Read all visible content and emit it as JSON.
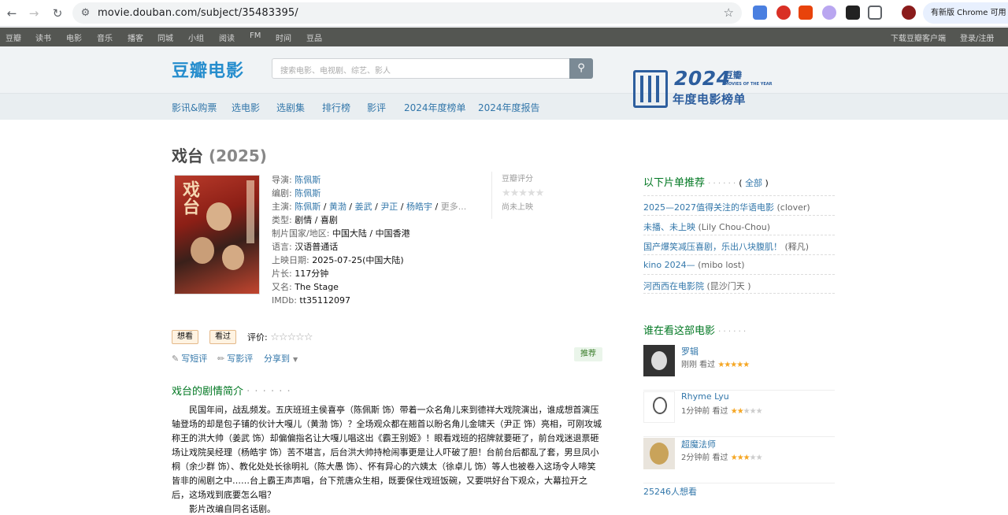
{
  "browser": {
    "url": "movie.douban.com/subject/35483395/",
    "update_label": "有新版 Chrome 可用"
  },
  "topnav": {
    "left": [
      "豆瓣",
      "读书",
      "电影",
      "音乐",
      "播客",
      "同城",
      "小组",
      "阅读",
      "FM",
      "时间",
      "豆品"
    ],
    "right": [
      "下载豆瓣客户端",
      "登录/注册"
    ]
  },
  "header": {
    "logo": "豆瓣电影",
    "search_placeholder": "搜索电影、电视剧、综艺、影人",
    "subnav": [
      "影讯&购票",
      "选电影",
      "选剧集",
      "排行榜",
      "影评",
      "2024年度榜单",
      "2024年度报告"
    ],
    "banner": {
      "year": "2024",
      "brand": "豆瓣",
      "sub": "MOVIES OF THE YEAR",
      "cn": "年度电影榜单"
    }
  },
  "movie": {
    "title": "戏台",
    "year": "(2025)",
    "info": {
      "director_label": "导演: ",
      "director": "陈佩斯",
      "writer_label": "编剧: ",
      "writer": "陈佩斯",
      "cast_label": "主演: ",
      "cast": [
        "陈佩斯",
        "黄渤",
        "姜武",
        "尹正",
        "杨皓宇"
      ],
      "cast_more": "更多...",
      "genre_label": "类型: ",
      "genre": "剧情 / 喜剧",
      "region_label": "制片国家/地区: ",
      "region": "中国大陆 / 中国香港",
      "language_label": "语言: ",
      "language": "汉语普通话",
      "release_label": "上映日期: ",
      "release": "2025-07-25(中国大陆)",
      "runtime_label": "片长: ",
      "runtime": "117分钟",
      "aka_label": "又名: ",
      "aka": "The Stage",
      "imdb_label": "IMDb: ",
      "imdb": "tt35112097"
    },
    "rating": {
      "label": "豆瓣评分",
      "stars": "★★★★★",
      "status": "尚未上映"
    },
    "buttons": {
      "want": "想看",
      "seen": "看过",
      "rate_label": "评价: ",
      "rate_stars": "☆☆☆☆☆"
    },
    "actions": {
      "short_review": "写短评",
      "review": "写影评",
      "share": "分享到",
      "recommend": "推荐"
    },
    "synopsis_title": "戏台的剧情简介",
    "synopsis_dots": "· · · · · ·",
    "synopsis": "民国年间，战乱频发。五庆班班主侯喜亭（陈佩斯 饰）带着一众名角儿来到德祥大戏院演出，谁成想首演压轴登场的却是包子铺的伙计大嘎儿（黄渤 饰）？全场观众都在翘首以盼名角儿金啸天（尹正 饰）亮相，可刚攻城称王的洪大帅（姜武 饰）却偏偏指名让大嘎儿唱这出《霸王别姬》！眼看戏班的招牌就要砸了，前台戏迷退票砸场让戏院吴经理（杨皓宇 饰）苦不堪言，后台洪大帅持枪闹事更是让人吓破了胆！台前台后都乱了套，男旦凤小桐（余少群 饰）、教化处处长徐明礼（陈大愚 饰）、怀有异心的六姨太（徐卓儿 饰）等人也被卷入这场令人啼笑皆非的闹剧之中……台上霸王声声唱，台下荒唐众生相，既要保住戏班饭碗，又要哄好台下观众，大幕拉开之后，这场戏到底要怎么唱？",
    "synopsis2": "影片改编自同名话剧。"
  },
  "aside": {
    "doulist_title": "以下片单推荐",
    "doulist_dots": "· · · · · ·",
    "doulist_all_prefix": "( ",
    "doulist_all": "全部",
    "doulist_all_suffix": " )",
    "doulist": [
      {
        "title": "2025—2027值得关注的华语电影",
        "by": "(clover)"
      },
      {
        "title": "未播、未上映",
        "by": "(Lily Chou-Chou)"
      },
      {
        "title": "国产爆笑减压喜剧，乐出八块腹肌！",
        "by": "(释凡)"
      },
      {
        "title": "kino 2024—",
        "by": "(mibo lost)"
      },
      {
        "title": "河西西在电影院",
        "by": "(昆沙门天 )"
      }
    ],
    "watching_title": "谁在看这部电影",
    "watching_dots": "· · · · · ·",
    "watchers": [
      {
        "name": "罗辑",
        "time": "刚刚 看过 ",
        "stars_on": "★★★★★",
        "stars_off": ""
      },
      {
        "name": "Rhyme Lyu",
        "time": "1分钟前 看过 ",
        "stars_on": "★★",
        "stars_off": "★★★"
      },
      {
        "name": "超魔法师",
        "time": "2分钟前 看过 ",
        "stars_on": "★★★",
        "stars_off": "★★"
      }
    ],
    "want_count": "25246人想看"
  }
}
